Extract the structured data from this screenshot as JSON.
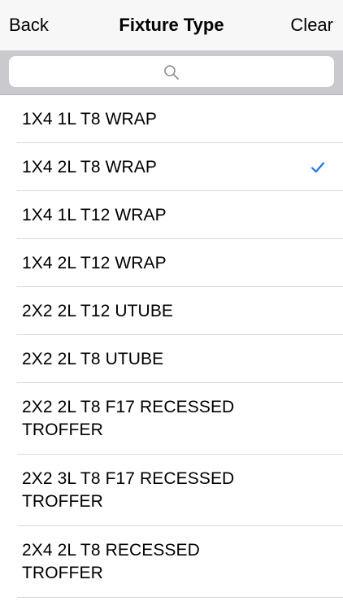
{
  "navbar": {
    "back_label": "Back",
    "title": "Fixture Type",
    "clear_label": "Clear"
  },
  "search": {
    "placeholder": "",
    "value": ""
  },
  "accent_color": "#1a73e8",
  "items": [
    {
      "label": "1X4 1L T8 WRAP",
      "selected": false
    },
    {
      "label": "1X4 2L T8 WRAP",
      "selected": true
    },
    {
      "label": "1X4 1L T12 WRAP",
      "selected": false
    },
    {
      "label": "1X4 2L T12 WRAP",
      "selected": false
    },
    {
      "label": "2X2 2L T12 UTUBE",
      "selected": false
    },
    {
      "label": "2X2 2L T8 UTUBE",
      "selected": false
    },
    {
      "label": "2X2 2L T8 F17 RECESSED TROFFER",
      "selected": false
    },
    {
      "label": "2X2 3L T8 F17 RECESSED TROFFER",
      "selected": false
    },
    {
      "label": "2X4 2L T8 RECESSED TROFFER",
      "selected": false
    }
  ]
}
